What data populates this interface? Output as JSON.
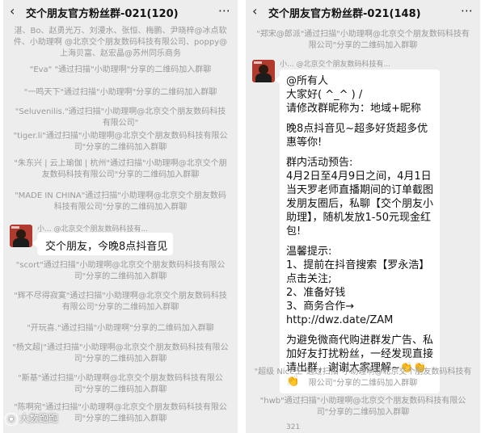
{
  "left_panel": {
    "title": "交个朋友官方粉丝群-021(120)",
    "system_messages": [
      "湛、Bo、赵勇光万、刘漫水、张恒、梅鹏、尹晓梓@冰点软件、小助理啊 @北京交个朋友数码科技有限公司、poppy@上海贝富、赵宏晶@苏州同乐商务",
      "\"Eva\" \"通过扫描\"小助理啊\"分享的二维码加入群聊",
      "\"一鸣天下\"通过扫描\"小助理啊\"分享的二维码加入群聊",
      "\"Seluvenilis.\"通过扫描\"小助理啊@北京交个朋友数码科技有限公司\"",
      "\"tiger.li\"通过扫描\"小助理啊@北京交个朋友数码科技有限公司\"分享的二维码加入群聊",
      "\"朱东兴 | 云上瑜伽 | 杭州\"通过扫描\"小助理啊@北京交个朋友数码科技有限公司\"分享的二维码加入群聊",
      "\"MADE IN CHINA\"通过扫描\"小助理啊@北京交个朋友数码科技有限公司\"分享的二维码加入群聊"
    ],
    "sender": "小... @北京交个朋友数码科技有...",
    "chat_message": "交个朋友，今晚8点抖音见",
    "system_messages_after": [
      "\"scort\"通过扫描\"小助理啊@北京交个朋友数码科技有限公司\"分享的二维码加入群聊",
      "\"辉不尽得寂寞\"通过扫描\"小助理啊@北京交个朋友数码科技有限公司\"分享的二维码加入群聊",
      "\"开玩喜.\"通过扫描\"小助理啊\"分享的二维码加入群聊",
      "\"杨文超|\"通过扫描\"小助理啊@北京交个朋友数码科技有限公司\"分享的二维码加入群聊",
      "\"斯基\"通过扫描\"小助理啊@北京交个朋友数码科技有限公司\"分享的二维码加入群聊",
      "\"陈啊宛\"通过扫描\"小助理啊@北京交个朋友数码科技有限公司\"分享的二维码加入群聊"
    ]
  },
  "right_panel": {
    "title": "交个朋友官方粉丝群-021(148)",
    "system_top": "\"郑宋@郎派\"通过扫描\"小助理啊@北京交个朋友数码科技有限公司\"分享的二维码加入群聊",
    "sender": "小... @北京交个朋友数码科技有...",
    "announcement": [
      "@所有人",
      "大家好( ^_^ ) /",
      "请修改群昵称为：地域+昵称",
      "",
      "晚8点抖音见~超多好货超多优惠等你!",
      "",
      "群内活动预告:",
      "4月2日至4月9日之间，4月1日当天罗老师直播期间的订单截图发朋友圈后，私聊【交个朋友小助理】，随机发放1-50元现金红包!",
      "",
      "温馨提示:",
      "1、提前在抖音搜索【罗永浩】点击关注;",
      "2、准备好钱",
      "3、商务合作→",
      "http://dwz.date/ZAM",
      "",
      "为避免微商代购进群发广告、私加好友打扰粉丝，一经发现直接请出群，谢谢大家理解~👏👏👏"
    ],
    "system_bottom": [
      "\"超级 Nice王\"通过扫描\"小助理啊@北京交个朋友数码科技有限公司\"分享的二维码加入群聊",
      "\"hwb\"通过扫描\"小助理啊@北京交个朋友数码科技有限公司\"分享的二维码加入群聊"
    ],
    "footer_count": "321"
  },
  "watermark": "大数跑跑"
}
